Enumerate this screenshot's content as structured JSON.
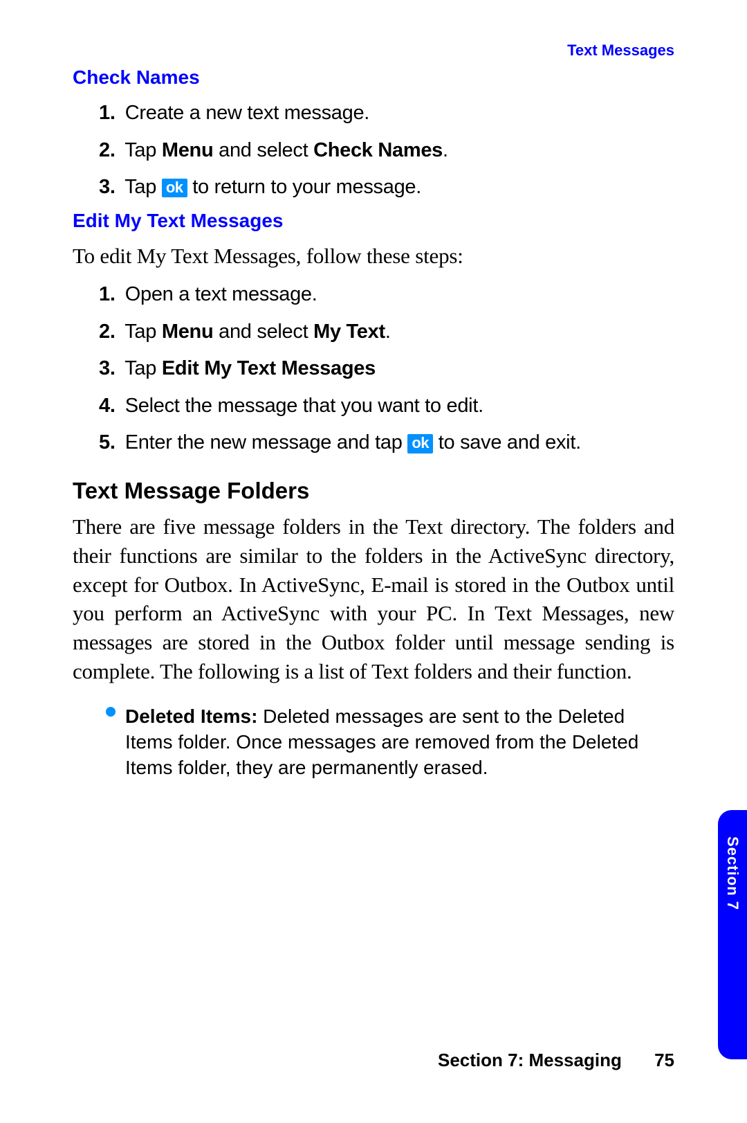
{
  "header": {
    "running_title": "Text Messages"
  },
  "check_names": {
    "heading": "Check Names",
    "steps": [
      {
        "n": "1.",
        "text": "Create a new text message."
      },
      {
        "n": "2.",
        "parts": [
          "Tap ",
          {
            "b": "Menu"
          },
          " and select ",
          {
            "b": "Check Names"
          },
          "."
        ]
      },
      {
        "n": "3.",
        "parts": [
          "Tap ",
          {
            "ok": true
          },
          " to return to your message."
        ]
      }
    ]
  },
  "edit_my_text": {
    "heading": "Edit My Text Messages",
    "intro": "To edit My Text Messages, follow these steps:",
    "steps": [
      {
        "n": "1.",
        "text": "Open a text message."
      },
      {
        "n": "2.",
        "parts": [
          "Tap ",
          {
            "b": "Menu"
          },
          " and select ",
          {
            "b": "My Text"
          },
          "."
        ]
      },
      {
        "n": "3.",
        "parts": [
          "Tap ",
          {
            "b": "Edit My Text Messages"
          }
        ]
      },
      {
        "n": "4.",
        "text": "Select the message that you want to edit."
      },
      {
        "n": "5.",
        "parts": [
          "Enter the new message and tap ",
          {
            "ok": true
          },
          " to save and exit."
        ]
      }
    ]
  },
  "folders": {
    "heading": "Text Message Folders",
    "paragraph": "There are five message folders in the Text directory. The folders and their functions are similar to the folders in the ActiveSync directory, except for Outbox. In ActiveSync, E-mail is stored in the Outbox until you perform an ActiveSync with your PC. In Text Messages, new messages are stored in the Outbox folder until message sending is complete. The following is a list of Text folders and their function.",
    "bullets": [
      {
        "label": "Deleted Items:",
        "text": " Deleted messages are sent to the Deleted Items folder. Once messages are removed from the Deleted Items folder, they are permanently erased."
      }
    ]
  },
  "ok_label": "ok",
  "tab": {
    "label": "Section 7"
  },
  "footer": {
    "section": "Section 7: Messaging",
    "page": "75"
  }
}
